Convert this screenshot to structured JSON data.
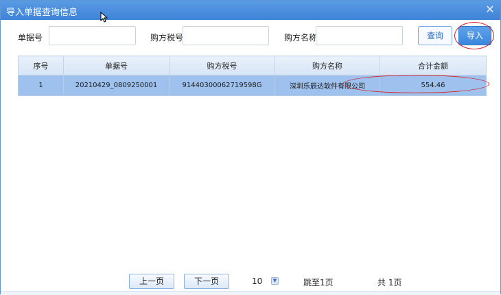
{
  "dialog": {
    "title": "导入单据查询信息"
  },
  "search": {
    "doc_no_label": "单据号",
    "doc_no_value": "",
    "buyer_tax_label": "购方税号",
    "buyer_tax_value": "",
    "buyer_name_label": "购方名称",
    "buyer_name_value": "",
    "query_label": "查询",
    "import_label": "导入"
  },
  "table": {
    "headers": [
      "序号",
      "单据号",
      "购方税号",
      "购方名称",
      "合计金额"
    ],
    "rows": [
      [
        "1",
        "20210429_0809250001",
        "91440300062719598G",
        "深圳乐辰达软件有限公司",
        "554.46"
      ]
    ]
  },
  "pager": {
    "prev_label": "上一页",
    "next_label": "下一页",
    "page_size": "10",
    "jump_text": "跳至1页",
    "total_text": "共 1页"
  },
  "colors": {
    "titlebar": "#3d83d8",
    "selected_row": "#9ec1ee",
    "annotation": "#d4242a"
  }
}
